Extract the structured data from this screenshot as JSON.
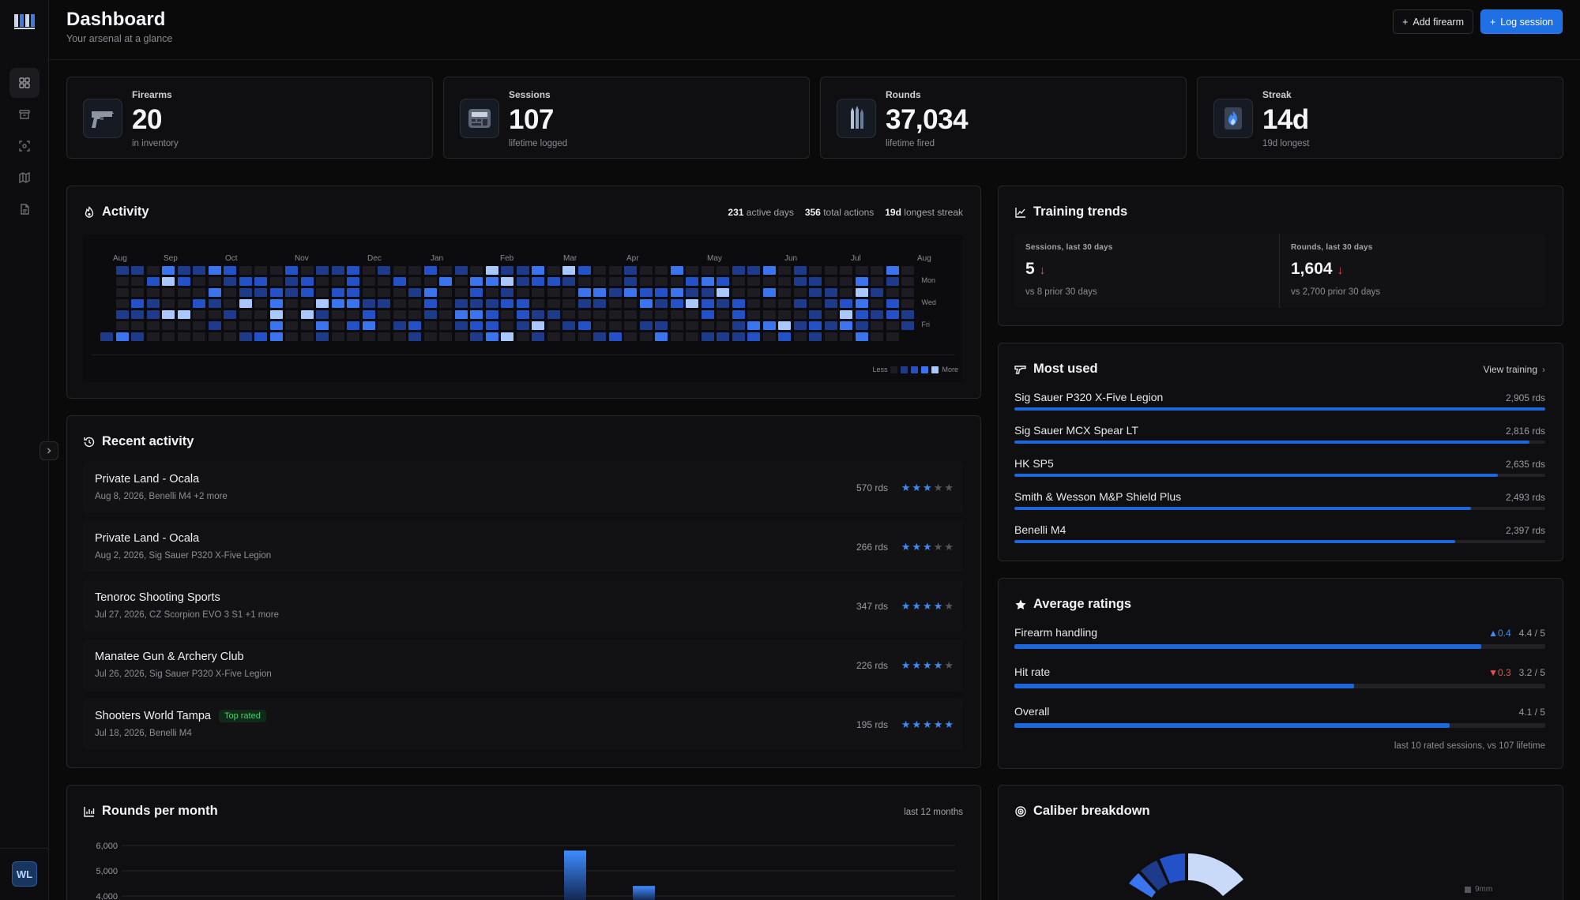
{
  "header": {
    "title": "Dashboard",
    "subtitle": "Your arsenal at a glance",
    "add_label": "Add firearm",
    "log_label": "Log session"
  },
  "user": {
    "initials": "WL"
  },
  "stats": [
    {
      "label": "Firearms",
      "value": "20",
      "sub": "in inventory",
      "icon": "pistol-icon"
    },
    {
      "label": "Sessions",
      "value": "107",
      "sub": "lifetime logged",
      "icon": "calculator-icon"
    },
    {
      "label": "Rounds",
      "value": "37,034",
      "sub": "lifetime fired",
      "icon": "bullets-icon"
    },
    {
      "label": "Streak",
      "value": "14d",
      "sub": "19d longest",
      "icon": "flame-icon"
    }
  ],
  "activity": {
    "title": "Activity",
    "active_days": "231",
    "active_days_label": "active days",
    "total_actions": "356",
    "total_actions_label": "total actions",
    "longest_streak": "19d",
    "longest_streak_label": "longest streak",
    "months": [
      "Aug",
      "Sep",
      "Oct",
      "Nov",
      "Dec",
      "Jan",
      "Feb",
      "Mar",
      "Apr",
      "May",
      "Jun",
      "Jul",
      "Aug"
    ],
    "weekdays": [
      "Mon",
      "Wed",
      "Fri"
    ],
    "legend_less": "Less",
    "legend_more": "More",
    "colors": [
      "#1c1c22",
      "#1e3a8a",
      "#2352c8",
      "#3a74ee",
      "#a9c8ff"
    ]
  },
  "recent": {
    "title": "Recent activity",
    "items": [
      {
        "title": "Private Land - Ocala",
        "sub": "Aug 8, 2026, Benelli M4 +2 more",
        "rds": "570 rds",
        "stars": 3,
        "badge": ""
      },
      {
        "title": "Private Land - Ocala",
        "sub": "Aug 2, 2026, Sig Sauer P320 X-Five Legion",
        "rds": "266 rds",
        "stars": 3,
        "badge": ""
      },
      {
        "title": "Tenoroc Shooting Sports",
        "sub": "Jul 27, 2026, CZ Scorpion EVO 3 S1 +1 more",
        "rds": "347 rds",
        "stars": 4,
        "badge": ""
      },
      {
        "title": "Manatee Gun & Archery Club",
        "sub": "Jul 26, 2026, Sig Sauer P320 X-Five Legion",
        "rds": "226 rds",
        "stars": 4,
        "badge": ""
      },
      {
        "title": "Shooters World Tampa",
        "sub": "Jul 18, 2026, Benelli M4",
        "rds": "195 rds",
        "stars": 5,
        "badge": "Top rated"
      }
    ]
  },
  "trends": {
    "title": "Training trends",
    "sessions": {
      "label": "Sessions, last 30 days",
      "value": "5",
      "sub": "vs 8 prior 30 days"
    },
    "rounds": {
      "label": "Rounds, last 30 days",
      "value": "1,604",
      "sub": "vs 2,700 prior 30 days"
    }
  },
  "most_used": {
    "title": "Most used",
    "link": "View training",
    "items": [
      {
        "name": "Sig Sauer P320 X-Five Legion",
        "value": "2,905 rds",
        "pct": 1.0
      },
      {
        "name": "Sig Sauer MCX Spear LT",
        "value": "2,816 rds",
        "pct": 0.97
      },
      {
        "name": "HK SP5",
        "value": "2,635 rds",
        "pct": 0.91
      },
      {
        "name": "Smith & Wesson M&P Shield Plus",
        "value": "2,493 rds",
        "pct": 0.86
      },
      {
        "name": "Benelli M4",
        "value": "2,397 rds",
        "pct": 0.83
      }
    ]
  },
  "ratings": {
    "title": "Average ratings",
    "items": [
      {
        "name": "Firearm handling",
        "delta": "0.4",
        "delta_dir": "up",
        "value": "4.4 / 5",
        "pct": 0.88
      },
      {
        "name": "Hit rate",
        "delta": "0.3",
        "delta_dir": "down",
        "value": "3.2 / 5",
        "pct": 0.64
      },
      {
        "name": "Overall",
        "delta": "",
        "delta_dir": "",
        "value": "4.1 / 5",
        "pct": 0.82
      }
    ],
    "footnote": "last 10 rated sessions, vs 107 lifetime"
  },
  "rounds_chart": {
    "title": "Rounds per month",
    "note": "last 12 months",
    "ticks": [
      "6,000",
      "5,000",
      "4,000"
    ]
  },
  "chart_data": {
    "type": "bar",
    "title": "Rounds per month",
    "ylim": [
      0,
      6000
    ],
    "visible_values": [
      5800,
      4400
    ]
  },
  "caliber": {
    "title": "Caliber breakdown",
    "legend_first": "9mm"
  }
}
